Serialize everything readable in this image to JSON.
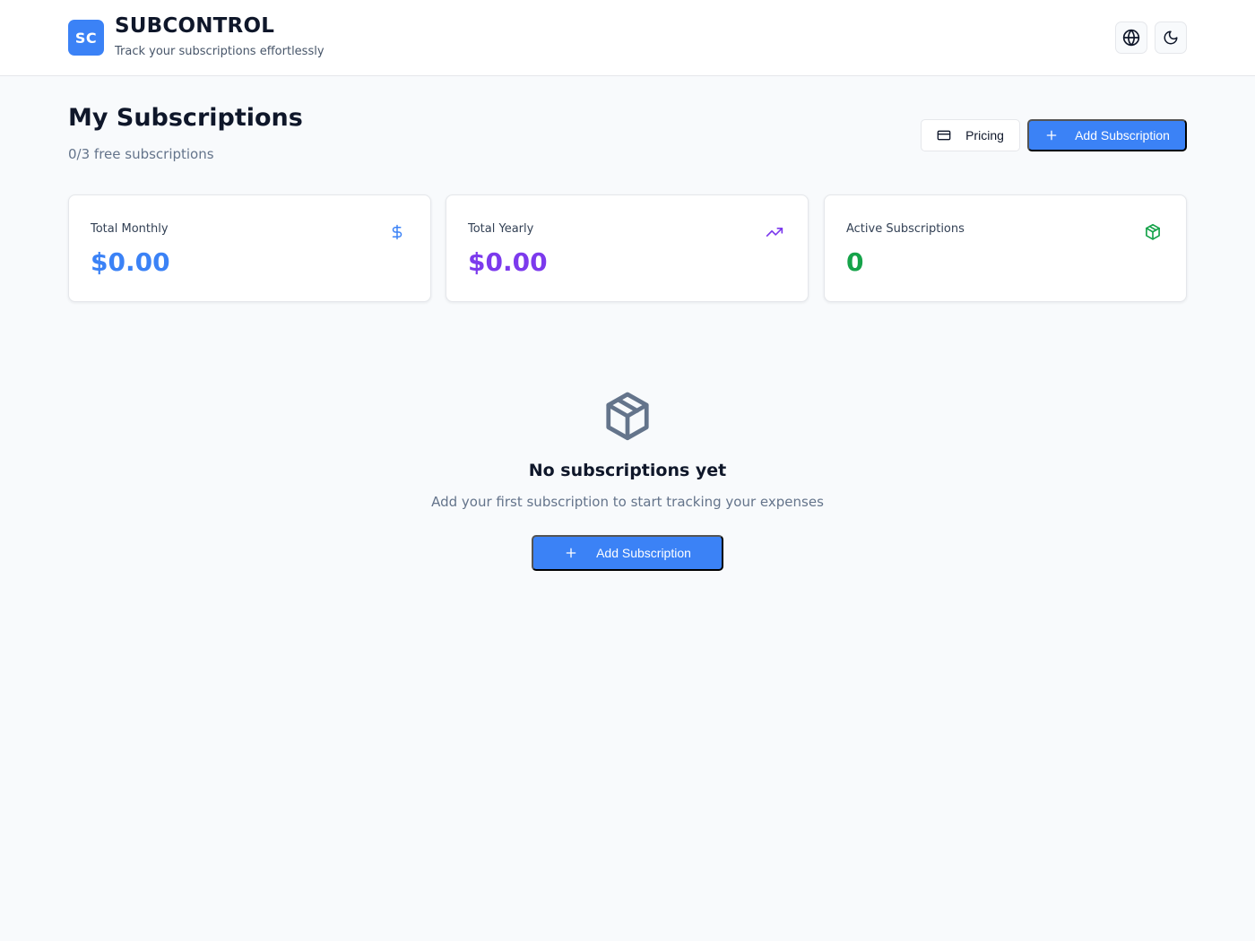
{
  "header": {
    "logo_text": "SC",
    "title": "SUBCONTROL",
    "tagline": "Track your subscriptions effortlessly",
    "language_icon": "globe-icon",
    "theme_icon": "moon-icon"
  },
  "page": {
    "title": "My Subscriptions",
    "subtitle": "0/3 free subscriptions"
  },
  "toolbar": {
    "pricing_label": "Pricing",
    "pricing_icon": "credit-card-icon",
    "add_label": "Add Subscription",
    "add_icon": "plus-icon"
  },
  "stats": [
    {
      "label": "Total Monthly",
      "value": "$0.00",
      "icon": "dollar-icon",
      "color": "#3b82f6"
    },
    {
      "label": "Total Yearly",
      "value": "$0.00",
      "icon": "trending-up-icon",
      "color": "#7c3aed"
    },
    {
      "label": "Active Subscriptions",
      "value": "0",
      "icon": "package-icon",
      "color": "#16a34a"
    }
  ],
  "empty_state": {
    "icon": "package-icon",
    "title": "No subscriptions yet",
    "description": "Add your first subscription to start tracking your expenses",
    "button_label": "Add Subscription"
  },
  "colors": {
    "primary": "#3b82f6",
    "background": "#f8fafc",
    "border": "#e5e7eb",
    "text": "#0f172a",
    "muted": "#64748b"
  }
}
